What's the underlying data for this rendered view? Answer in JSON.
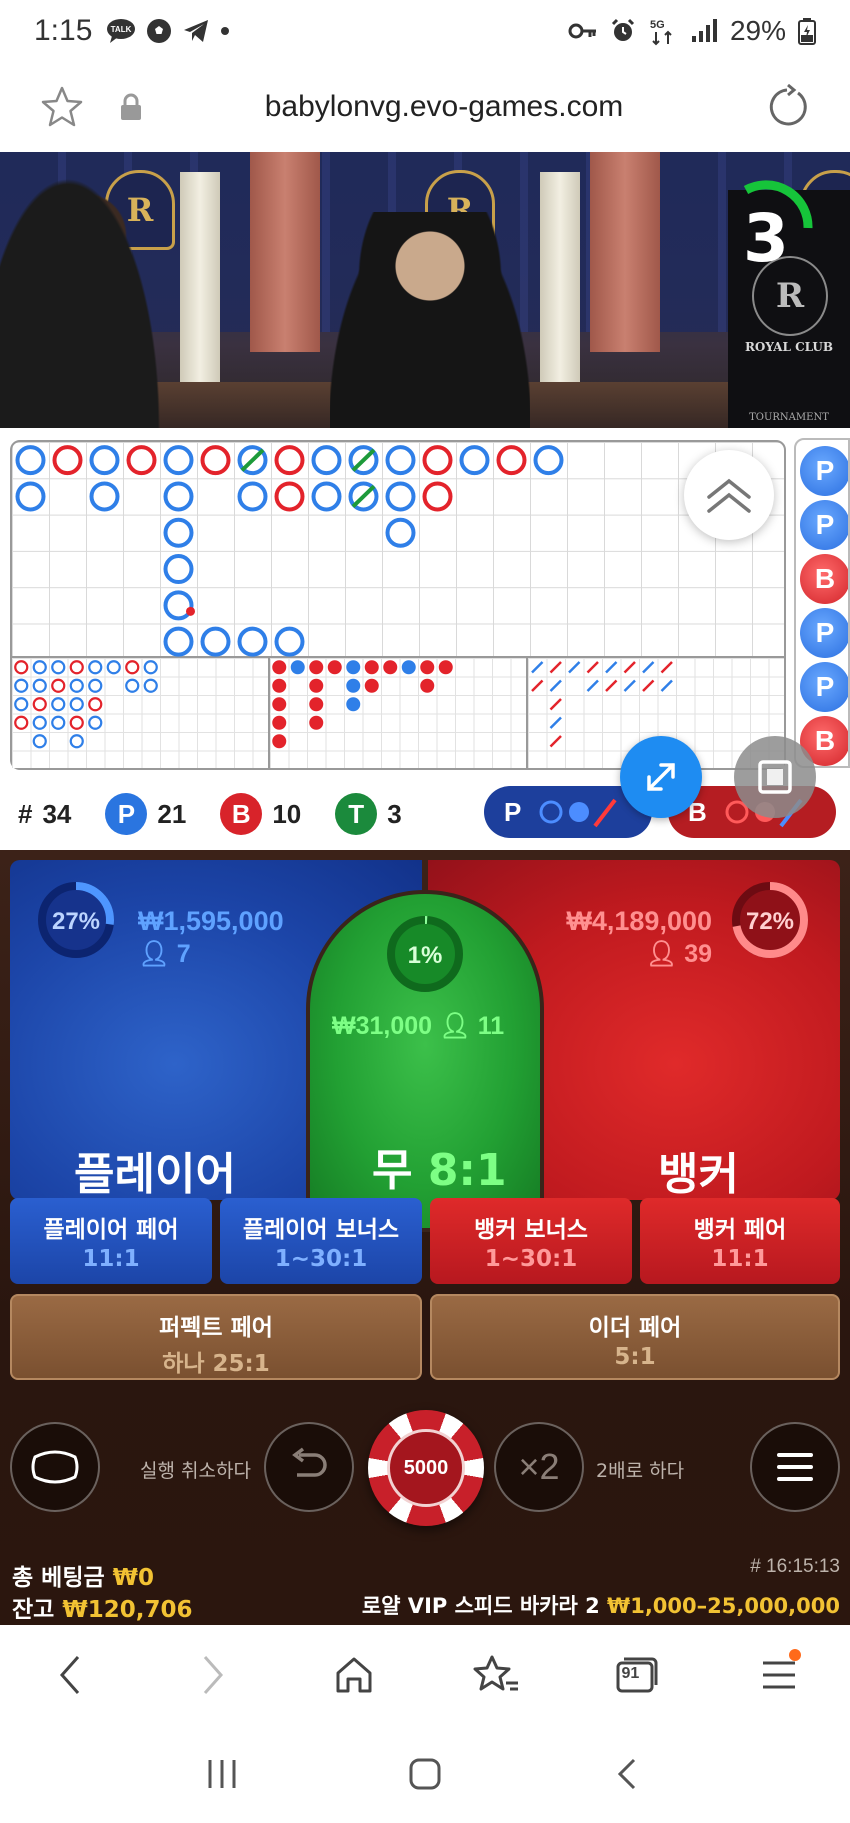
{
  "status_bar": {
    "time": "1:15",
    "left_icons": [
      "talk-icon",
      "soccer-icon",
      "telegram-icon",
      "dot-icon"
    ],
    "battery": "29%"
  },
  "browser": {
    "url": "babylonvg.evo-games.com"
  },
  "video": {
    "countdown": "3",
    "logo_name": "ROYAL CLUB",
    "logo_sub": "TOURNAMENT"
  },
  "road_side": [
    "P",
    "P",
    "B",
    "P",
    "P",
    "B"
  ],
  "stats": {
    "hash_label": "#",
    "total": "34",
    "player_letter": "P",
    "player": "21",
    "banker_letter": "B",
    "banker": "10",
    "tie_letter": "T",
    "tie": "3"
  },
  "predict": {
    "player_label": "P",
    "banker_label": "B"
  },
  "bets": {
    "player": {
      "label": "플레이어",
      "amount": "₩1,595,000",
      "count": "7",
      "pct": "27%",
      "pct_value": 27
    },
    "tie": {
      "label": "무",
      "odds": "8:1",
      "amount": "₩31,000",
      "count": "11",
      "pct": "1%",
      "pct_value": 1
    },
    "banker": {
      "label": "뱅커",
      "amount": "₩4,189,000",
      "count": "39",
      "pct": "72%",
      "pct_value": 72
    }
  },
  "side_bets": [
    {
      "label": "플레이어 페어",
      "odds": "11:1"
    },
    {
      "label": "플레이어 보너스",
      "odds": "1~30:1"
    },
    {
      "label": "뱅커 보너스",
      "odds": "1~30:1"
    },
    {
      "label": "뱅커 페어",
      "odds": "11:1"
    }
  ],
  "pair_bets": [
    {
      "label": "퍼펙트 페어",
      "odds": "하나 25:1"
    },
    {
      "label": "이더 페어",
      "odds": "5:1"
    }
  ],
  "controls": {
    "undo_label": "실행 취소하다",
    "chip_value": "5000",
    "double_symbol": "×2",
    "double_label": "2배로 하다"
  },
  "footer": {
    "total_bet_label": "총 베팅금",
    "total_bet": "₩0",
    "balance_label": "잔고",
    "balance": "₩120,706",
    "game_time": "# 16:15:13",
    "table_name": "로얄 VIP 스피드 바카라 2",
    "limits": "₩1,000–25,000,000"
  },
  "browser_nav": {
    "tabs_count": "91"
  },
  "colors": {
    "player_blue": "#1c45a8",
    "banker_red": "#c01a1f",
    "tie_green": "#22a033",
    "gold": "#f2c233"
  }
}
